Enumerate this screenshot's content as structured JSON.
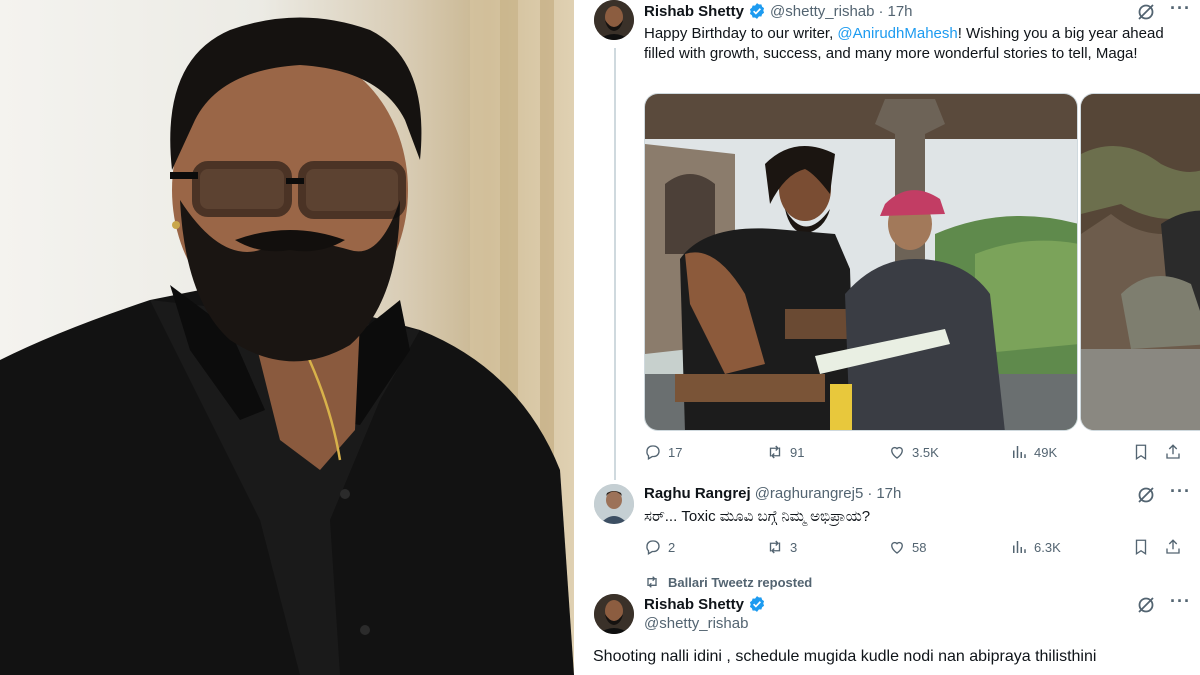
{
  "tweets": [
    {
      "name": "Rishab Shetty",
      "handle": "@shetty_rishab",
      "time": "17h",
      "text_before": "Happy Birthday to our writer,  ",
      "mention": "@AnirudhMahesh",
      "text_after": "! Wishing you a big year ahead filled with growth, success, and many more wonderful stories to tell, Maga!",
      "replies": "17",
      "reposts": "91",
      "likes": "3.5K",
      "views": "49K"
    },
    {
      "name": "Raghu Rangrej",
      "handle": "@raghurangrej5",
      "time": "17h",
      "text": "ಸರ್... Toxic ಮೂವಿ ಬಗ್ಗೆ ನಿಮ್ಮ ಅಭಿಪ್ರಾಯ?",
      "replies": "2",
      "reposts": "3",
      "likes": "58",
      "views": "6.3K"
    },
    {
      "repost_label": "Ballari Tweetz reposted",
      "name": "Rishab Shetty",
      "handle": "@shetty_rishab",
      "text": "Shooting nalli idini , schedule mugida kudle nodi nan abipraya thilisthini"
    }
  ],
  "colors": {
    "accent": "#1d9bf0",
    "secondary_text": "#536471",
    "primary_text": "#0f1419",
    "border": "#cfd9de"
  },
  "icons": [
    "verified-badge-icon",
    "grok-icon",
    "more-icon",
    "reply-icon",
    "repost-icon",
    "like-icon",
    "views-icon",
    "bookmark-icon",
    "share-icon"
  ]
}
